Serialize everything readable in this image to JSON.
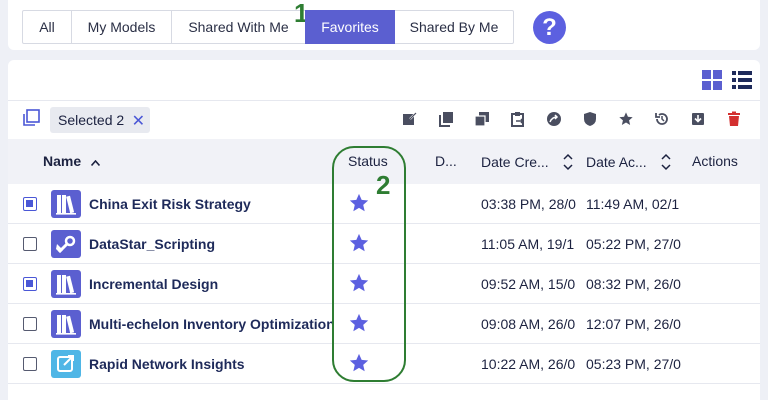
{
  "tabs": [
    {
      "label": "All",
      "active": false
    },
    {
      "label": "My Models",
      "active": false
    },
    {
      "label": "Shared With Me",
      "active": false
    },
    {
      "label": "Favorites",
      "active": true
    },
    {
      "label": "Shared By Me",
      "active": false
    }
  ],
  "help_label": "?",
  "annotations": {
    "one": "1",
    "two": "2"
  },
  "selection_chip": {
    "label": "Selected 2",
    "close": "✕"
  },
  "toolbar_icons": [
    "edit-icon",
    "copy-icon",
    "duplicate-icon",
    "paste-icon",
    "share-icon",
    "shield-icon",
    "star-icon",
    "history-icon",
    "archive-icon",
    "delete-icon"
  ],
  "columns": {
    "name": "Name",
    "status": "Status",
    "d": "D...",
    "date_created": "Date Cre...",
    "date_accessed": "Date Ac...",
    "actions": "Actions"
  },
  "rows": [
    {
      "checked": true,
      "icon": "books-icon",
      "name": "China Exit Risk Strategy",
      "status": "favorite",
      "created": "03:38 PM, 28/0",
      "accessed": "11:49 AM, 02/1"
    },
    {
      "checked": false,
      "icon": "wrench-icon",
      "name": "DataStar_Scripting",
      "status": "favorite",
      "created": "11:05 AM, 19/1",
      "accessed": "05:22 PM, 27/0"
    },
    {
      "checked": true,
      "icon": "books-icon",
      "name": "Incremental Design",
      "status": "favorite",
      "created": "09:52 AM, 15/0",
      "accessed": "08:32 PM, 26/0"
    },
    {
      "checked": false,
      "icon": "books-icon",
      "name": "Multi-echelon Inventory Optimization",
      "status": "favorite",
      "created": "09:08 AM, 26/0",
      "accessed": "12:07 PM, 26/0"
    },
    {
      "checked": false,
      "icon": "external-link-icon",
      "name": "Rapid Network Insights",
      "status": "favorite",
      "created": "10:22 AM, 26/0",
      "accessed": "05:23 PM, 27/0"
    }
  ],
  "colors": {
    "accent": "#5b5fd0",
    "star": "#5c60e0",
    "annotation": "#2e7d32",
    "delete": "#d32f2f"
  }
}
